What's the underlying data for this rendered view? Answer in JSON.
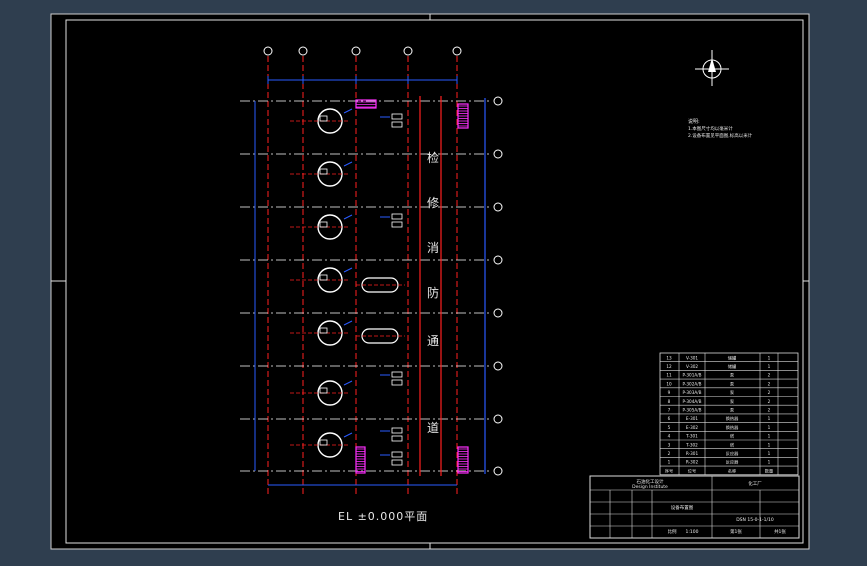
{
  "colors": {
    "background": "#2f3e4f",
    "sheet": "#000000",
    "grid_line": "#ff2020",
    "column_line": "#ff2020",
    "dimension": "#2a5bff",
    "equipment": "#ffffff",
    "accent": "#ff30ff",
    "text": "#e8e8e8"
  },
  "plan_caption": "EL ±0.000平面",
  "vertical_label_chars": [
    "检",
    "修",
    "消",
    "防",
    "通",
    "道"
  ],
  "notes": {
    "heading": "说明:",
    "lines": [
      "1.本图尺寸均以毫米计",
      "2.设备布置见平面图,标高以米计"
    ]
  },
  "equipment_list": {
    "rows": [
      [
        "13",
        "V-301",
        "储罐",
        "1"
      ],
      [
        "12",
        "V-302",
        "储罐",
        "1"
      ],
      [
        "11",
        "P-301A/B",
        "泵",
        "2"
      ],
      [
        "10",
        "P-302A/B",
        "泵",
        "2"
      ],
      [
        "9",
        "P-303A/B",
        "泵",
        "2"
      ],
      [
        "8",
        "P-304A/B",
        "泵",
        "2"
      ],
      [
        "7",
        "P-305A/B",
        "泵",
        "2"
      ],
      [
        "6",
        "E-301",
        "换热器",
        "1"
      ],
      [
        "5",
        "E-302",
        "换热器",
        "1"
      ],
      [
        "4",
        "T-301",
        "塔",
        "1"
      ],
      [
        "3",
        "T-302",
        "塔",
        "1"
      ],
      [
        "2",
        "R-301",
        "反应器",
        "1"
      ],
      [
        "1",
        "R-302",
        "反应器",
        "1"
      ]
    ],
    "header": [
      "序号",
      "位号",
      "名称",
      "数量"
    ]
  },
  "title_block": {
    "org_line1": "石油化工设计",
    "org_line2": "Design Institute",
    "project": "化工厂",
    "drawing_name": "设备布置图",
    "drawing_no": "DSN 15-0-1-1/10",
    "scale_label": "比例",
    "scale": "1:100",
    "sheet_label": "第1张",
    "total_label": "共1张"
  }
}
